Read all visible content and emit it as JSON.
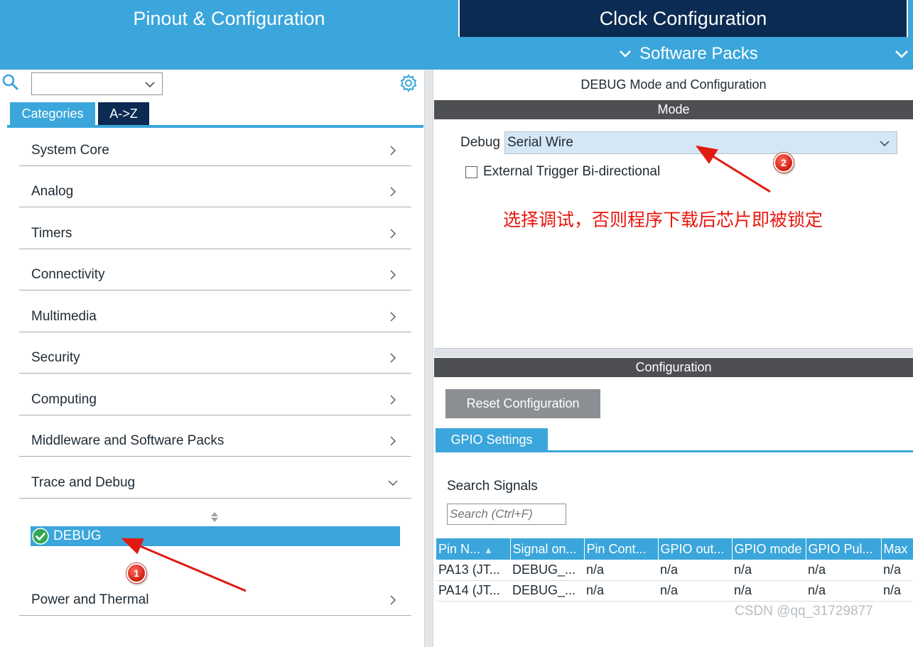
{
  "header": {
    "tabs": [
      {
        "label": "Pinout & Configuration",
        "active": true
      },
      {
        "label": "Clock Configuration",
        "active": false
      }
    ],
    "software_packs_label": "Software Packs"
  },
  "sidebar": {
    "search": {
      "value": ""
    },
    "tabs": [
      "Categories",
      "A->Z"
    ],
    "items": [
      {
        "label": "System Core",
        "state": "collapsed"
      },
      {
        "label": "Analog",
        "state": "collapsed"
      },
      {
        "label": "Timers",
        "state": "collapsed"
      },
      {
        "label": "Connectivity",
        "state": "collapsed"
      },
      {
        "label": "Multimedia",
        "state": "collapsed"
      },
      {
        "label": "Security",
        "state": "collapsed"
      },
      {
        "label": "Computing",
        "state": "collapsed"
      },
      {
        "label": "Middleware and Software Packs",
        "state": "collapsed"
      },
      {
        "label": "Trace and Debug",
        "state": "expanded"
      }
    ],
    "sub_item": {
      "label": "DEBUG",
      "selected": true,
      "status": "enabled"
    },
    "after_items": [
      {
        "label": "Power and Thermal",
        "state": "collapsed"
      }
    ]
  },
  "main": {
    "title": "DEBUG Mode and Configuration",
    "mode_header": "Mode",
    "debug_label": "Debug",
    "debug_value": "Serial Wire",
    "external_trigger_label": "External Trigger Bi-directional",
    "external_trigger_checked": false,
    "annotation_text": "选择调试，否则程序下载后芯片即被锁定",
    "config_header": "Configuration",
    "reset_button": "Reset Configuration",
    "gpio_tab": "GPIO Settings",
    "search_signals_label": "Search Signals",
    "search_signals_placeholder": "Search (Ctrl+F)",
    "table": {
      "columns": [
        "Pin N...",
        "Signal on...",
        "Pin Cont...",
        "GPIO out...",
        "GPIO mode",
        "GPIO Pul...",
        "Max"
      ],
      "rows": [
        [
          "PA13 (JT...",
          "DEBUG_...",
          "n/a",
          "n/a",
          "n/a",
          "n/a",
          "n/a"
        ],
        [
          "PA14 (JT...",
          "DEBUG_...",
          "n/a",
          "n/a",
          "n/a",
          "n/a",
          "n/a"
        ]
      ]
    }
  },
  "markers": [
    "1",
    "2"
  ],
  "watermark": "CSDN @qq_31729877",
  "colors": {
    "accent": "#3aa6db",
    "dark_navy": "#0b2b52",
    "section_bar": "#4d4f52",
    "annotation": "#e8170e",
    "select_bg": "#d5e6f5"
  }
}
